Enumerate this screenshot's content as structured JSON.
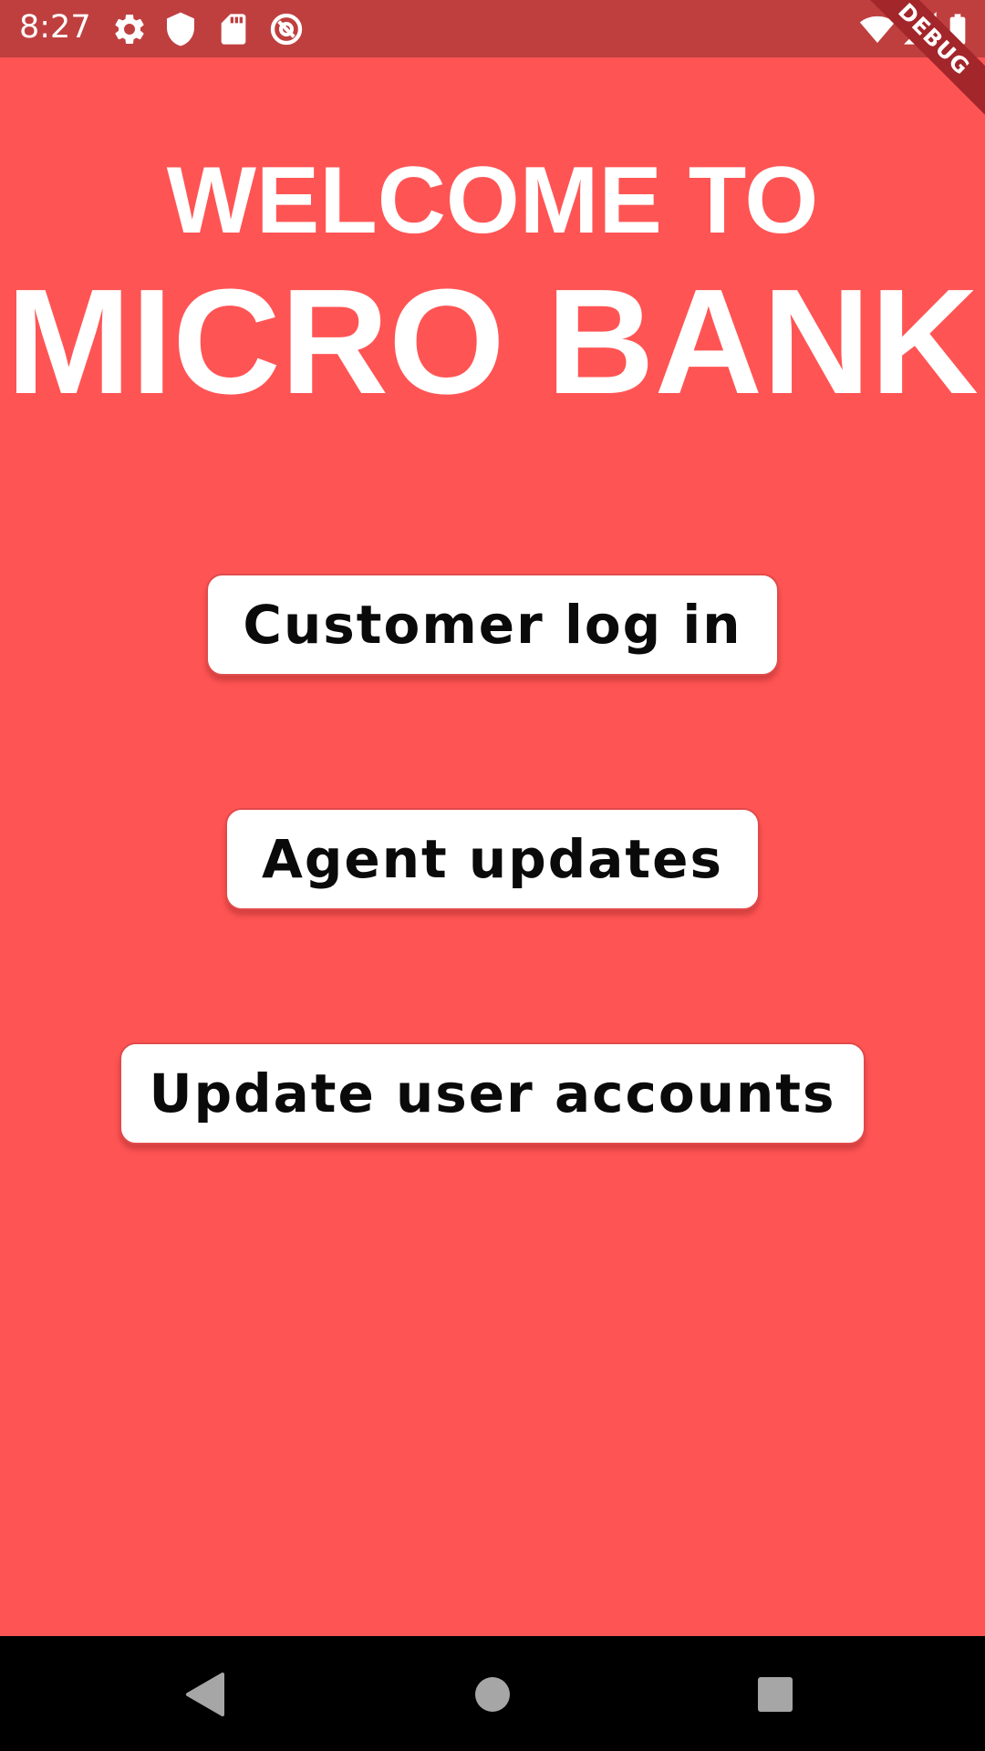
{
  "status_bar": {
    "time": "8:27",
    "icons_left": [
      "settings-icon",
      "shield-icon",
      "sd-card-icon",
      "at-sign-icon"
    ],
    "icons_right": [
      "wifi-icon",
      "signal-icon",
      "battery-icon"
    ],
    "debug_banner": "DEBUG",
    "background_color": "#bf3f3f"
  },
  "header": {
    "line1": "WELCOME TO",
    "line2": "MICRO BANK"
  },
  "buttons": {
    "customer_login": "Customer log in",
    "agent_updates": "Agent updates",
    "update_user_accounts": "Update user accounts"
  },
  "colors": {
    "background": "#ff5454",
    "button_background": "#ffffff",
    "button_text": "#0a0a0a",
    "debug_ribbon": "#a3262b"
  },
  "nav_bar": {
    "buttons": [
      "back-icon",
      "home-icon",
      "recents-icon"
    ]
  }
}
